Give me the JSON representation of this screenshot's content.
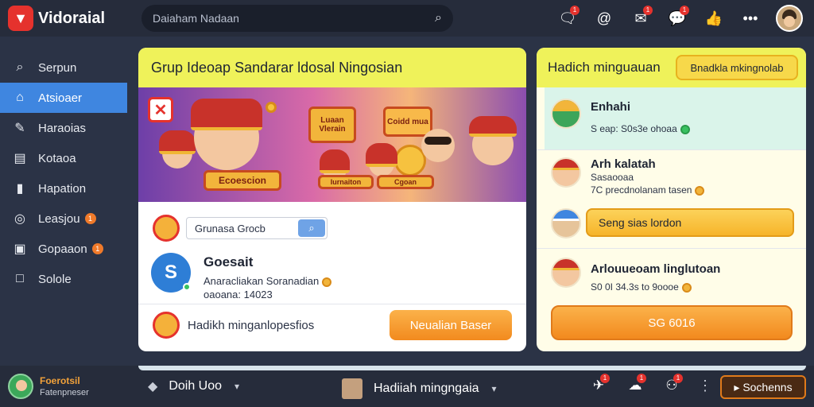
{
  "app": {
    "name": "Vidoraial"
  },
  "search": {
    "placeholder": "Daiaham Nadaan"
  },
  "top_icons": [
    {
      "name": "notifications-icon",
      "badge": "1"
    },
    {
      "name": "mention-icon",
      "badge": ""
    },
    {
      "name": "chat-icon",
      "badge": "1"
    },
    {
      "name": "messages-icon",
      "badge": "1"
    },
    {
      "name": "like-icon",
      "badge": ""
    },
    {
      "name": "more-icon",
      "badge": ""
    }
  ],
  "sidebar": {
    "items": [
      {
        "label": "Serpun",
        "icon": "search-icon",
        "badge": ""
      },
      {
        "label": "Atsioaer",
        "icon": "home-icon",
        "badge": ""
      },
      {
        "label": "Haraoias",
        "icon": "pen-icon",
        "badge": ""
      },
      {
        "label": "Kotaoa",
        "icon": "book-icon",
        "badge": ""
      },
      {
        "label": "Hapation",
        "icon": "document-icon",
        "badge": ""
      },
      {
        "label": "Leasjou",
        "icon": "compass-icon",
        "badge": "1"
      },
      {
        "label": "Gopaaon",
        "icon": "image-icon",
        "badge": "1"
      },
      {
        "label": "Solole",
        "icon": "square-icon",
        "badge": ""
      }
    ]
  },
  "main": {
    "title": "Grup Ideoap Sandarar ldosal Ningosian",
    "banner": {
      "sign_left": "Ecoescion",
      "sign_top1": "Luaan Vlerain",
      "sign_top2": "Coidd mua",
      "sign_small1": "Iurnaiton",
      "sign_small2": "Cgoan"
    },
    "group": {
      "name": "Grunasa Grocb"
    },
    "user": {
      "name": "Goesait",
      "line1": "Anaracliakan Soranadian",
      "line2": "oaoana: 14023"
    },
    "reward": {
      "text": "Hadikh minganlopesfios",
      "button": "Neualian Baser"
    }
  },
  "right": {
    "title": "Hadich minguauan",
    "header_button": "Bnadkla mkingnolab",
    "entries": [
      {
        "title": "Enhahi",
        "sub": "S eap: S0s3e ohoaa"
      },
      {
        "title": "Arh kalatah",
        "sub": "Sasaooaa",
        "sub2": "7C precdnolanam tasen"
      },
      {
        "button": "Seng sias lordon"
      },
      {
        "title": "Arlouueoam linglutoan",
        "sub": "S0 0I 34.3s to 9oooe"
      },
      {
        "button": "SG 6016"
      }
    ]
  },
  "bottom": {
    "user_name": "Foerotsil",
    "user_role": "Fatenpneser",
    "item1": "Doih Uoo",
    "item2": "Hadiiah mingngaia",
    "icons": [
      {
        "name": "rocket-icon",
        "badge": "1"
      },
      {
        "name": "notification-icon",
        "badge": "1"
      },
      {
        "name": "team-icon",
        "badge": "1"
      }
    ],
    "button": "Sochenns"
  },
  "colors": {
    "accent": "#3f86e0",
    "header_yellow": "#eff25a",
    "orange": "#f28a1e",
    "brand_red": "#e5322d"
  }
}
